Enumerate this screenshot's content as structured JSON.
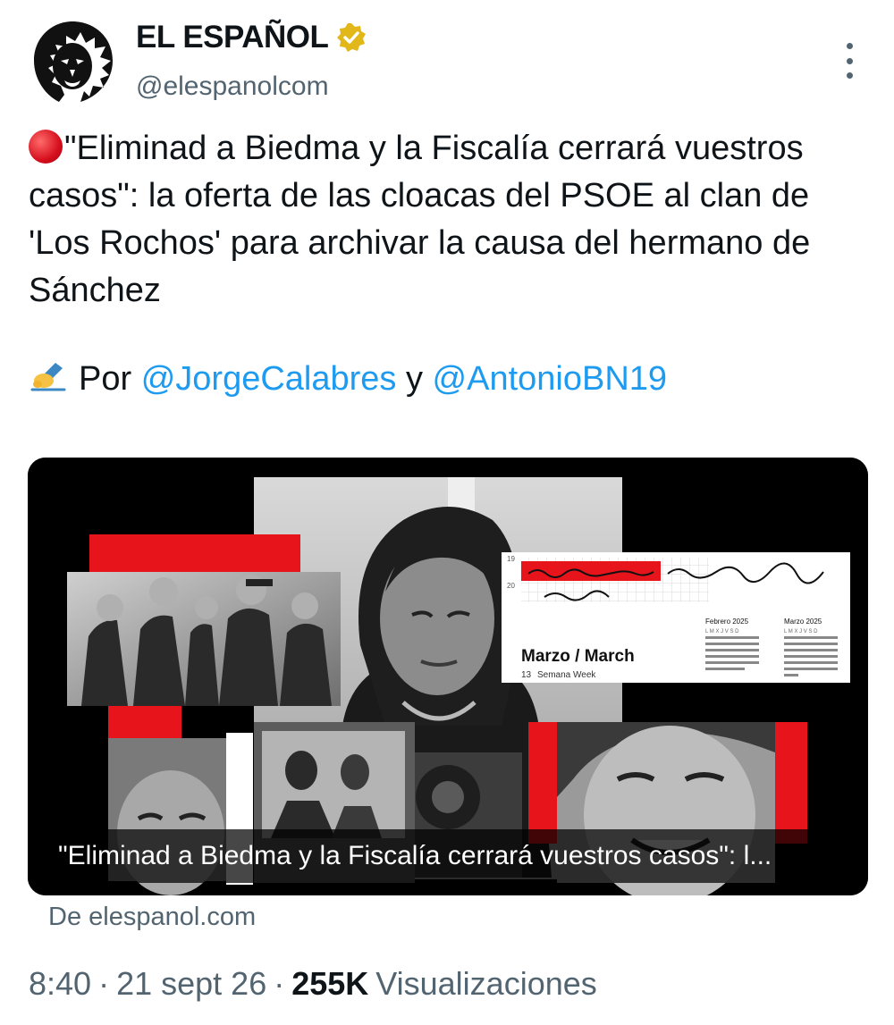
{
  "account": {
    "display_name": "EL ESPAÑOL",
    "handle": "@elespanolcom",
    "verified_badge": "gold-verified-badge",
    "avatar": "lion-logo",
    "more_icon": "more-vertical-icon"
  },
  "tweet": {
    "text": "\"Eliminad a Biedma y la Fiscalía cerrará vuestros casos\": la oferta de las cloacas del PSOE al clan de 'Los Rochos' para archivar la causa del hermano de Sánchez",
    "lead_emoji": "red-circle",
    "byline": {
      "emoji": "writing-hand",
      "prefix": "Por",
      "mention_1": "@JorgeCalabres",
      "connector": "y",
      "mention_2": "@AntonioBN19"
    }
  },
  "link_card": {
    "caption": "\"Eliminad a Biedma y la Fiscalía cerrará vuestros casos\": l...",
    "source": "De elespanol.com",
    "calendar": {
      "row_19": "19",
      "row_20": "20",
      "title": "Marzo / March",
      "week_number": "13",
      "week_label": "Semana Week",
      "mini_month_1": "Febrero 2025",
      "mini_month_2": "Marzo 2025",
      "weekday_header": "L M X J V S D"
    }
  },
  "meta": {
    "time": "8:40",
    "date": "21 sept 26",
    "views_count": "255K",
    "views_label": "Visualizaciones"
  },
  "colors": {
    "text": "#0f1419",
    "secondary": "#536471",
    "link": "#1d9bf0",
    "accent_red": "#e8141c",
    "badge_gold": "#e2b719"
  }
}
